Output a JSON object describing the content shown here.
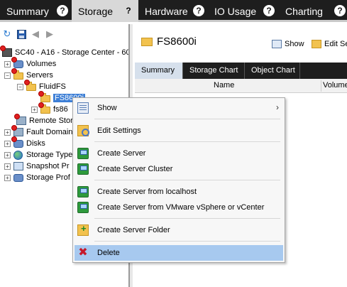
{
  "top_tabs": [
    {
      "label": "Summary",
      "help": "?"
    },
    {
      "label": "Storage",
      "help": "?"
    },
    {
      "label": "Hardware",
      "help": "?"
    },
    {
      "label": "IO Usage",
      "help": "?"
    },
    {
      "label": "Charting",
      "help": "?"
    }
  ],
  "tree": {
    "root": "SC40 - A16 - Storage Center - 60",
    "items": [
      {
        "label": "Volumes"
      },
      {
        "label": "Servers"
      },
      {
        "label": "FluidFS"
      },
      {
        "label": "FS8600i"
      },
      {
        "label": "fs86"
      },
      {
        "label": "Remote Stora"
      },
      {
        "label": "Fault Domain"
      },
      {
        "label": "Disks"
      },
      {
        "label": "Storage Type"
      },
      {
        "label": "Snapshot Pr"
      },
      {
        "label": "Storage Prof"
      }
    ]
  },
  "detail": {
    "title": "FS8600i",
    "show_button": "Show",
    "edit_button": "Edit Se",
    "tabs": [
      "Summary",
      "Storage Chart",
      "Object Chart"
    ],
    "columns": [
      "Name",
      "Volume"
    ]
  },
  "context_menu": {
    "items": [
      {
        "label": "Show",
        "icon": "show-icon",
        "submenu": true
      },
      {
        "label": "Edit Settings",
        "icon": "edit-settings-icon"
      },
      {
        "label": "Create Server",
        "icon": "create-server-icon"
      },
      {
        "label": "Create Server Cluster",
        "icon": "create-server-cluster-icon"
      },
      {
        "label": "Create Server from localhost",
        "icon": "create-server-localhost-icon"
      },
      {
        "label": "Create Server from VMware vSphere or vCenter",
        "icon": "create-server-vmware-icon"
      },
      {
        "label": "Create Server Folder",
        "icon": "create-server-folder-icon"
      },
      {
        "label": "Delete",
        "icon": "delete-icon",
        "highlighted": true
      }
    ]
  }
}
